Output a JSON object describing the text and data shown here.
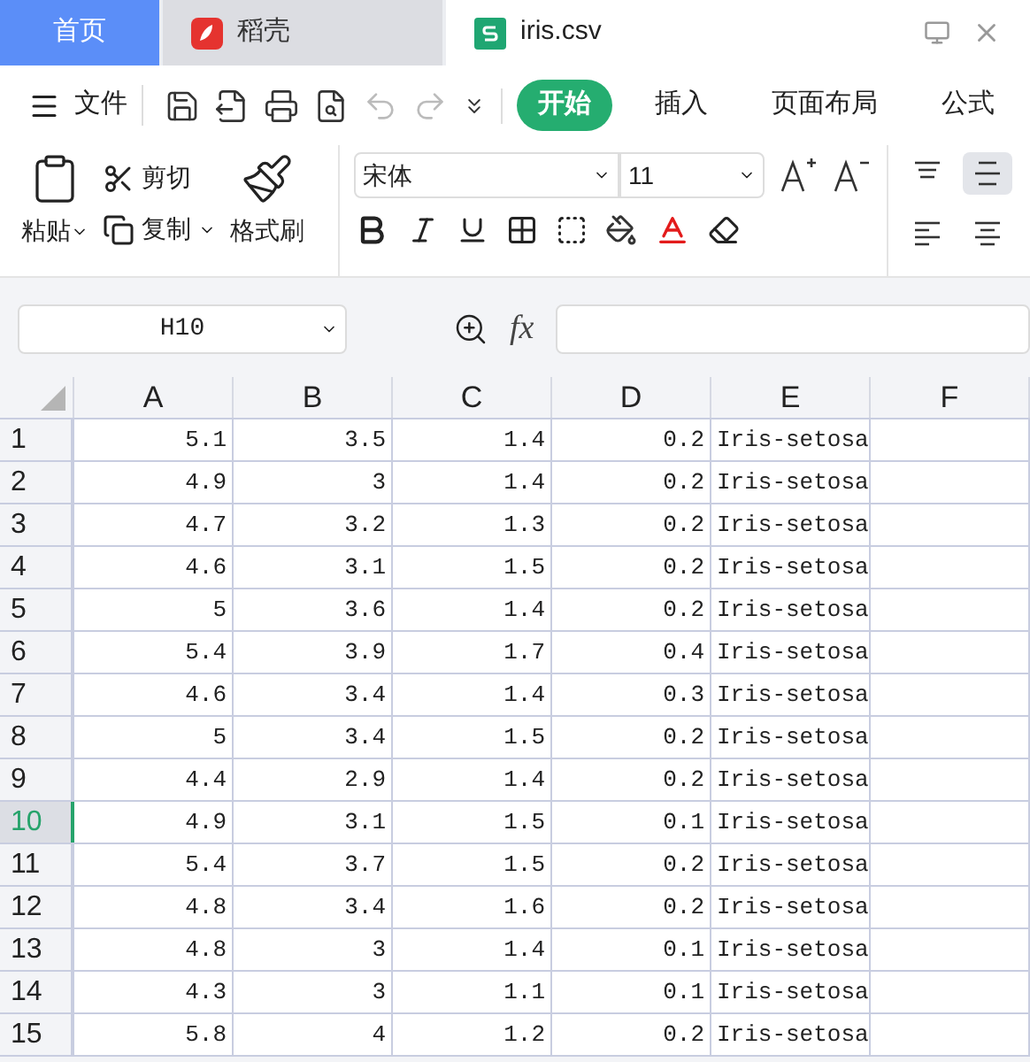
{
  "tabs": [
    {
      "label": "首页",
      "kind": "home",
      "selected": false
    },
    {
      "label": "稻壳",
      "kind": "docer",
      "selected": false
    },
    {
      "label": "iris.csv",
      "kind": "sheet",
      "selected": true
    }
  ],
  "menu": {
    "file": "文件",
    "tabs": [
      {
        "label": "开始",
        "selected": true
      },
      {
        "label": "插入",
        "selected": false
      },
      {
        "label": "页面布局",
        "selected": false
      },
      {
        "label": "公式",
        "selected": false
      }
    ]
  },
  "quick_tools": [
    {
      "kind": "save",
      "disabled": false
    },
    {
      "kind": "export",
      "disabled": false
    },
    {
      "kind": "print",
      "disabled": false
    },
    {
      "kind": "preview",
      "disabled": false
    },
    {
      "kind": "undo",
      "disabled": true
    },
    {
      "kind": "redo",
      "disabled": true
    },
    {
      "kind": "more",
      "disabled": false
    }
  ],
  "clipboard": {
    "paste": "粘贴",
    "cut": "剪切",
    "copy": "复制",
    "format_painter": "格式刷"
  },
  "font": {
    "name": "宋体",
    "size": "11"
  },
  "alignment": [
    {
      "kind": "top",
      "selected": false
    },
    {
      "kind": "middle",
      "selected": true
    },
    {
      "kind": "left",
      "selected": false
    },
    {
      "kind": "center",
      "selected": false
    }
  ],
  "name_box": "H10",
  "formula_label": "fx",
  "sheet": {
    "columns": [
      "A",
      "B",
      "C",
      "D",
      "E",
      "F"
    ],
    "rows": [
      {
        "number": "1",
        "selected": false,
        "cells": [
          "5.1",
          "3.5",
          "1.4",
          "0.2",
          "Iris-setosa"
        ]
      },
      {
        "number": "2",
        "selected": false,
        "cells": [
          "4.9",
          "3",
          "1.4",
          "0.2",
          "Iris-setosa"
        ]
      },
      {
        "number": "3",
        "selected": false,
        "cells": [
          "4.7",
          "3.2",
          "1.3",
          "0.2",
          "Iris-setosa"
        ]
      },
      {
        "number": "4",
        "selected": false,
        "cells": [
          "4.6",
          "3.1",
          "1.5",
          "0.2",
          "Iris-setosa"
        ]
      },
      {
        "number": "5",
        "selected": false,
        "cells": [
          "5",
          "3.6",
          "1.4",
          "0.2",
          "Iris-setosa"
        ]
      },
      {
        "number": "6",
        "selected": false,
        "cells": [
          "5.4",
          "3.9",
          "1.7",
          "0.4",
          "Iris-setosa"
        ]
      },
      {
        "number": "7",
        "selected": false,
        "cells": [
          "4.6",
          "3.4",
          "1.4",
          "0.3",
          "Iris-setosa"
        ]
      },
      {
        "number": "8",
        "selected": false,
        "cells": [
          "5",
          "3.4",
          "1.5",
          "0.2",
          "Iris-setosa"
        ]
      },
      {
        "number": "9",
        "selected": false,
        "cells": [
          "4.4",
          "2.9",
          "1.4",
          "0.2",
          "Iris-setosa"
        ]
      },
      {
        "number": "10",
        "selected": true,
        "cells": [
          "4.9",
          "3.1",
          "1.5",
          "0.1",
          "Iris-setosa"
        ]
      },
      {
        "number": "11",
        "selected": false,
        "cells": [
          "5.4",
          "3.7",
          "1.5",
          "0.2",
          "Iris-setosa"
        ]
      },
      {
        "number": "12",
        "selected": false,
        "cells": [
          "4.8",
          "3.4",
          "1.6",
          "0.2",
          "Iris-setosa"
        ]
      },
      {
        "number": "13",
        "selected": false,
        "cells": [
          "4.8",
          "3",
          "1.4",
          "0.1",
          "Iris-setosa"
        ]
      },
      {
        "number": "14",
        "selected": false,
        "cells": [
          "4.3",
          "3",
          "1.1",
          "0.1",
          "Iris-setosa"
        ]
      },
      {
        "number": "15",
        "selected": false,
        "cells": [
          "5.8",
          "4",
          "1.2",
          "0.2",
          "Iris-setosa"
        ]
      }
    ]
  }
}
